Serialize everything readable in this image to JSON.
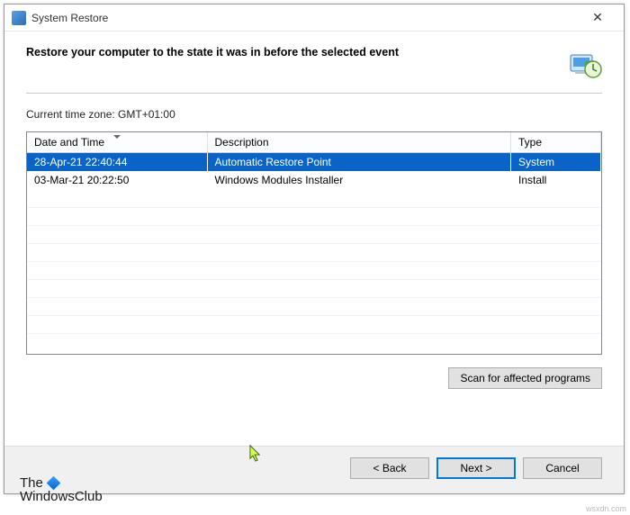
{
  "window": {
    "title": "System Restore",
    "close_glyph": "✕"
  },
  "header": {
    "heading": "Restore your computer to the state it was in before the selected event"
  },
  "body": {
    "timezone_label": "Current time zone: GMT+01:00",
    "columns": {
      "datetime": "Date and Time",
      "description": "Description",
      "type": "Type"
    },
    "rows": [
      {
        "datetime": "28-Apr-21 22:40:44",
        "description": "Automatic Restore Point",
        "type": "System",
        "selected": true
      },
      {
        "datetime": "03-Mar-21 20:22:50",
        "description": "Windows Modules Installer",
        "type": "Install",
        "selected": false
      }
    ],
    "scan_button": "Scan for affected programs"
  },
  "footer": {
    "back": "< Back",
    "next": "Next >",
    "cancel": "Cancel"
  },
  "watermark": {
    "line1": "The",
    "line2": "WindowsClub",
    "corner": "wsxdn.com"
  }
}
